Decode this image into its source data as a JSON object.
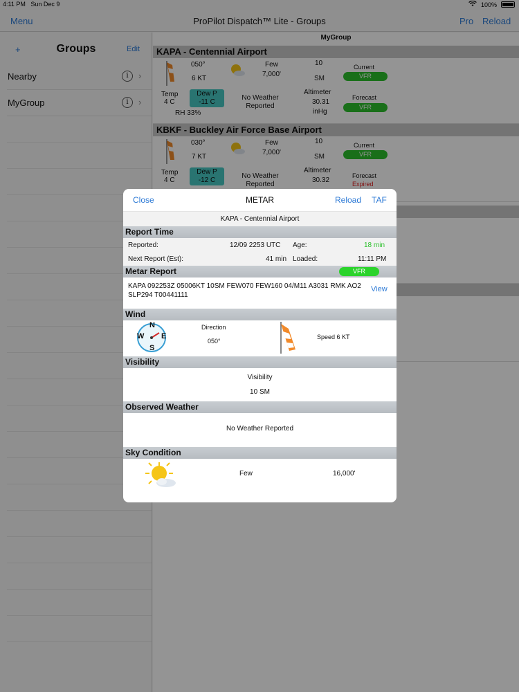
{
  "status": {
    "time": "4:11 PM",
    "date": "Sun Dec 9",
    "battery": "100%"
  },
  "nav": {
    "menu": "Menu",
    "title": "ProPilot Dispatch™ Lite - Groups",
    "pro": "Pro",
    "reload": "Reload"
  },
  "sidebar": {
    "plus": "+",
    "title": "Groups",
    "edit": "Edit",
    "items": [
      {
        "label": "Nearby"
      },
      {
        "label": "MyGroup"
      }
    ]
  },
  "main": {
    "group_title": "MyGroup",
    "airports": [
      {
        "name": "KAPA - Centennial Airport",
        "wind_dir": "050°",
        "wind_speed": "6 KT",
        "sky": "Few",
        "sky_alt": "7,000'",
        "vis": "10",
        "vis_unit": "SM",
        "temp_label": "Temp",
        "temp": "4 C",
        "dew_label": "Dew P",
        "dew": "-11 C",
        "rh": "RH 33%",
        "weather": "No Weather Reported",
        "alt_label": "Altimeter",
        "alt": "30.31",
        "alt_unit": "inHg",
        "current_label": "Current",
        "current": "VFR",
        "forecast_label": "Forecast",
        "forecast": "VFR"
      },
      {
        "name": "KBKF - Buckley Air Force Base Airport",
        "wind_dir": "030°",
        "wind_speed": "7 KT",
        "sky": "Few",
        "sky_alt": "7,000'",
        "vis": "10",
        "vis_unit": "SM",
        "temp_label": "Temp",
        "temp": "4 C",
        "dew_label": "Dew P",
        "dew": "-12 C",
        "weather": "No Weather Reported",
        "alt_label": "Altimeter",
        "alt": "30.32",
        "current_label": "Current",
        "current": "VFR",
        "forecast_label": "Forecast",
        "forecast": "Expired"
      }
    ]
  },
  "modal": {
    "close": "Close",
    "title": "METAR",
    "reload": "Reload",
    "taf": "TAF",
    "airport": "KAPA - Centennial Airport",
    "report_time": {
      "heading": "Report Time",
      "reported_label": "Reported:",
      "reported": "12/09 2253 UTC",
      "age_label": "Age:",
      "age": "18 min",
      "next_label": "Next Report (Est):",
      "next": "41 min",
      "loaded_label": "Loaded:",
      "loaded": "11:11 PM"
    },
    "metar": {
      "heading": "Metar Report",
      "flight_rule": "VFR",
      "text": "KAPA 092253Z 05006KT 10SM FEW070 FEW160 04/M11 A3031 RMK AO2 SLP294 T00441111",
      "view": "View"
    },
    "wind": {
      "heading": "Wind",
      "direction_label": "Direction",
      "direction": "050°",
      "speed": "Speed 6 KT",
      "compass": {
        "n": "N",
        "s": "S",
        "e": "E",
        "w": "W"
      }
    },
    "visibility": {
      "heading": "Visibility",
      "label": "Visibility",
      "value": "10 SM"
    },
    "observed": {
      "heading": "Observed Weather",
      "value": "No Weather Reported"
    },
    "sky": {
      "heading": "Sky Condition",
      "cover": "Few",
      "altitude": "16,000'"
    }
  }
}
